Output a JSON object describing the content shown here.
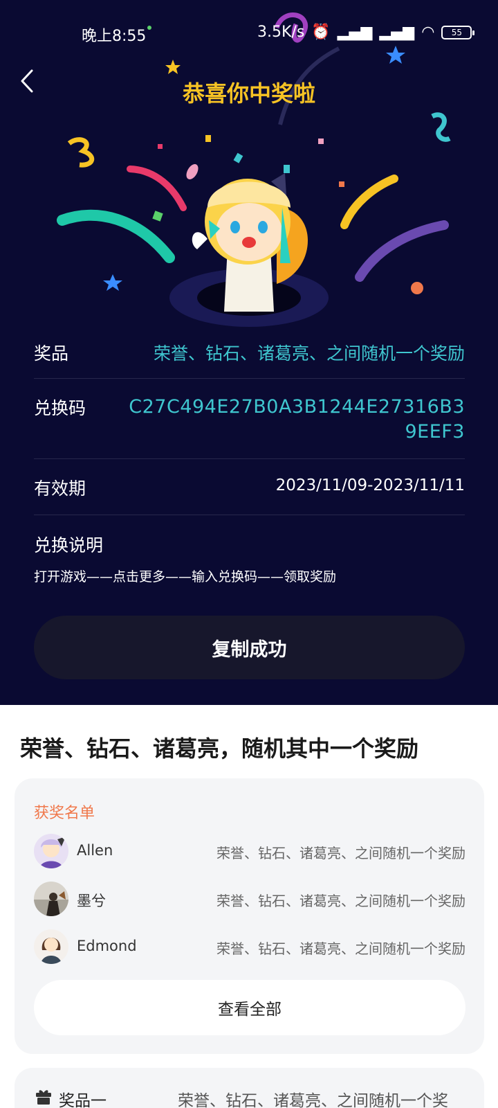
{
  "status_bar": {
    "time": "晚上8:55",
    "right_text": "3.5K/s",
    "battery": "55"
  },
  "header": {
    "title": "恭喜你中奖啦",
    "back_icon": "chevron-left-icon"
  },
  "prize": {
    "label": "奖品",
    "value": "荣誉、钻石、诸葛亮、之间随机一个奖励"
  },
  "code": {
    "label": "兑换码",
    "value": "C27C494E27B0A3B1244E27316B39EEF3"
  },
  "validity": {
    "label": "有效期",
    "value": "2023/11/09-2023/11/11"
  },
  "redeem": {
    "title": "兑换说明",
    "steps": "打开游戏——点击更多——输入兑换码——领取奖励"
  },
  "copy_button": "复制成功",
  "section_title": "荣誉、钻石、诸葛亮，随机其中一个奖励",
  "winners": {
    "title": "获奖名单",
    "items": [
      {
        "name": "Allen",
        "prize": "荣誉、钻石、诸葛亮、之间随机一个奖励"
      },
      {
        "name": "墨兮",
        "prize": "荣誉、钻石、诸葛亮、之间随机一个奖励"
      },
      {
        "name": "Edmond",
        "prize": "荣誉、钻石、诸葛亮、之间随机一个奖励"
      }
    ],
    "view_all": "查看全部"
  },
  "prize_card": {
    "label": "奖品一",
    "value": "荣誉、钻石、诸葛亮、之间随机一个奖",
    "icon": "gift-icon"
  },
  "colors": {
    "hero_bg": "#0a0a32",
    "title": "#f7c324",
    "accent": "#3fc6cf",
    "winners_title": "#f0784b"
  }
}
